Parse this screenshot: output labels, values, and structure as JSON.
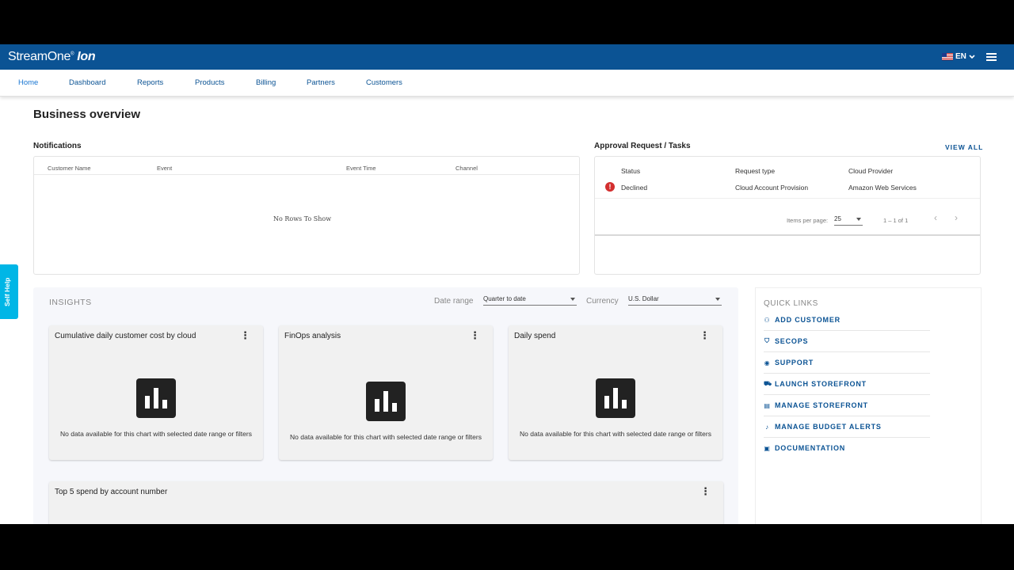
{
  "brand": {
    "name": "StreamOne",
    "suffix": "Ion",
    "registered": "®"
  },
  "header": {
    "language": "EN"
  },
  "nav": [
    "Home",
    "Dashboard",
    "Reports",
    "Products",
    "Billing",
    "Partners",
    "Customers"
  ],
  "page_title": "Business overview",
  "notifications": {
    "title": "Notifications",
    "columns": [
      "Customer Name",
      "Event",
      "Event Time",
      "Channel"
    ],
    "empty_message": "No Rows To Show"
  },
  "approvals": {
    "title": "Approval Request / Tasks",
    "view_all": "VIEW ALL",
    "columns": [
      "Status",
      "Request type",
      "Cloud Provider"
    ],
    "rows": [
      {
        "status": "Declined",
        "request_type": "Cloud Account Provision",
        "cloud_provider": "Amazon Web Services"
      }
    ],
    "pager": {
      "items_per_page_label": "Items per page:",
      "items_per_page": "25",
      "range": "1 – 1 of 1"
    }
  },
  "insights": {
    "title": "INSIGHTS",
    "date_range_label": "Date range",
    "date_range_value": "Quarter to date",
    "currency_label": "Currency",
    "currency_value": "U.S. Dollar",
    "charts": [
      {
        "title": "Cumulative daily customer cost by cloud",
        "message": "No data available for this chart with selected date range or filters"
      },
      {
        "title": "FinOps analysis",
        "message": "No data available for this chart with selected date range or filters"
      },
      {
        "title": "Daily spend",
        "message": "No data available for this chart with selected date range or filters"
      },
      {
        "title": "Top 5 spend by account number"
      }
    ]
  },
  "quick_links": {
    "title": "QUICK LINKS",
    "items": [
      {
        "label": "ADD CUSTOMER",
        "icon": "add-person-icon"
      },
      {
        "label": "SECOPS",
        "icon": "shield-icon"
      },
      {
        "label": "SUPPORT",
        "icon": "support-icon"
      },
      {
        "label": "LAUNCH STOREFRONT",
        "icon": "cart-icon"
      },
      {
        "label": "MANAGE STOREFRONT",
        "icon": "storefront-icon"
      },
      {
        "label": "MANAGE BUDGET ALERTS",
        "icon": "budget-alert-icon"
      },
      {
        "label": "DOCUMENTATION",
        "icon": "document-icon"
      }
    ]
  },
  "self_help": "Self Help",
  "colors": {
    "brand_blue": "#0b5394",
    "self_help": "#00b6e6",
    "error": "#d32f2f"
  }
}
